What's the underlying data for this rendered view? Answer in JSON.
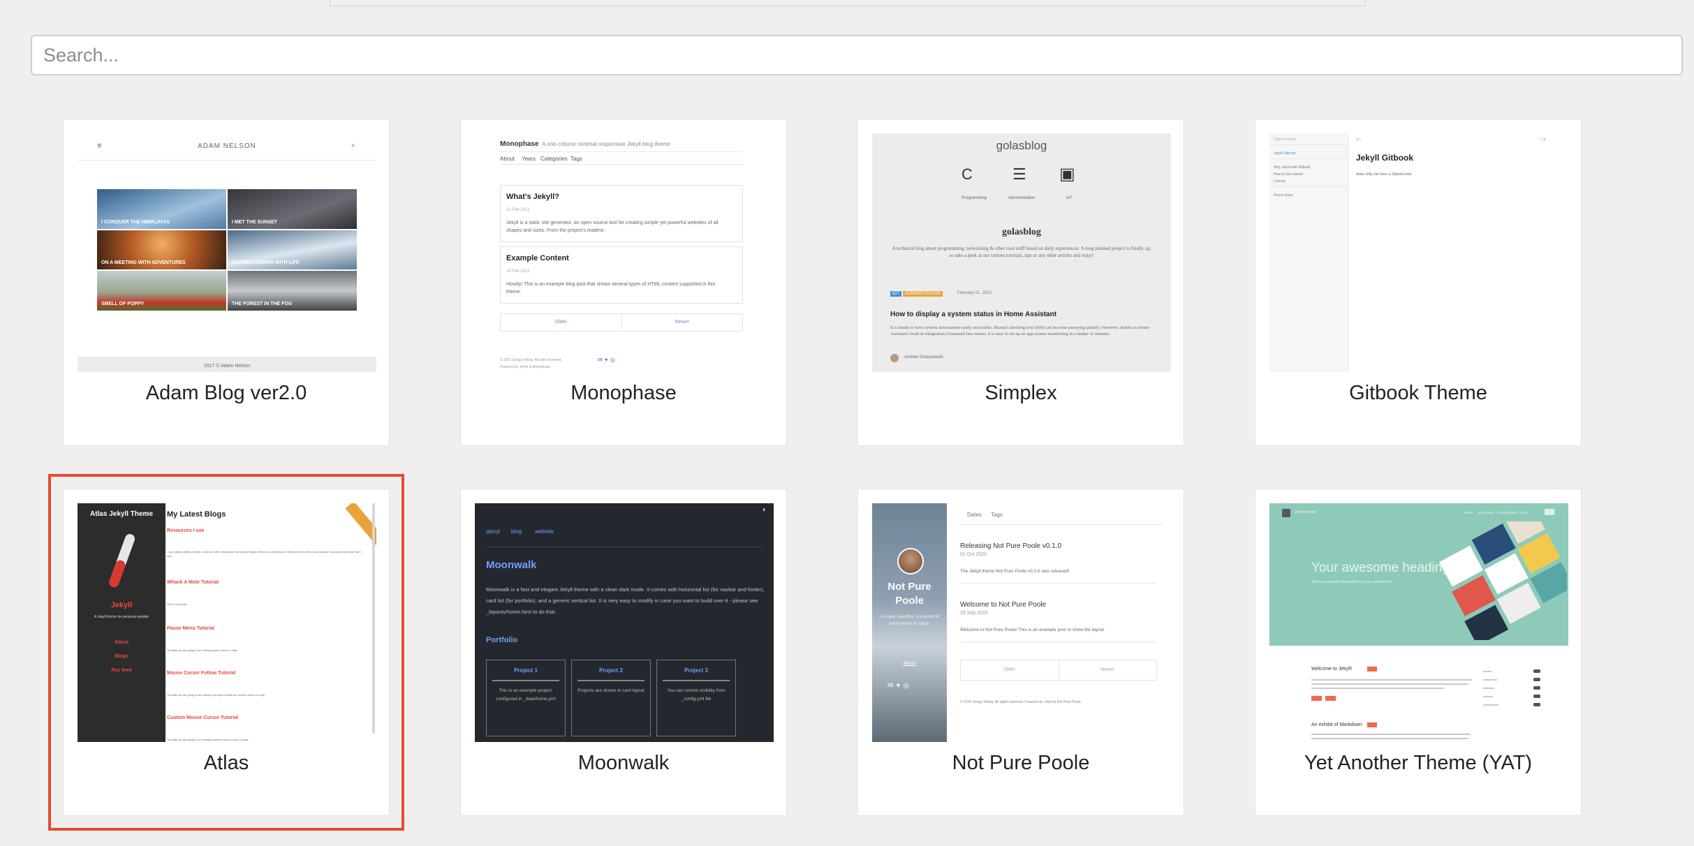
{
  "search": {
    "placeholder": "Search..."
  },
  "themes": [
    {
      "title": "Adam Blog ver2.0",
      "preview": {
        "brand": "ADAM NELSON",
        "tiles": [
          "I CONQUER THE HIMALAYAS",
          "I MET THE SUNSET",
          "ON A MEETING WITH ADVENTURES",
          "SNOWBOARDING WITH LIFE",
          "SMELL OF POPPY",
          "THE FOREST IN THE FOG"
        ],
        "footer": "2017 © Adam Nelson"
      }
    },
    {
      "title": "Monophase",
      "preview": {
        "brand": "Monophase",
        "tagline": "A one-column minimal responsive Jekyll blog theme",
        "nav": [
          "About",
          "Years",
          "Categories",
          "Tags"
        ],
        "posts": [
          {
            "title": "What's Jekyll?",
            "date": "21 Feb 2021",
            "excerpt": "Jekyll is a static site generator, an open-source tool for creating simple yet powerful websites of all shapes and sizes. From the project's readme:"
          },
          {
            "title": "Example Content",
            "date": "18 Feb 2021",
            "excerpt": "Howdy! This is an example blog post that shows several types of HTML content supported in this theme."
          }
        ],
        "pager": [
          "Older",
          "Newer"
        ],
        "footer": "© 2021 Songyi Wang. All right reserved.",
        "powered": "Powered by Jekyll & Monophase"
      }
    },
    {
      "title": "Simplex",
      "preview": {
        "brand": "golasblog",
        "cats": [
          "Programming",
          "Administration",
          "IoT"
        ],
        "heading": "golasblog",
        "desc": "A technical blog about programming, networking & other cool stuff based on daily experiences. A long planned project is finally up, so take a peek at our various tutorials, tips or any other articles and enjoy!",
        "tags": [
          "IOT",
          "ADMINISTRATION"
        ],
        "date": "February 01, 2021",
        "post": "How to display a system status in Home Assistant",
        "excerpt": "It is handy to have system information easily accessible. Manual checking (via SSH) can become annoying quickly. However, thanks to Home Assistant's built-in integration Command line sensor, it is easy to set up an app system monitoring in a matter of minutes.",
        "author": "Andrew Golaszewski"
      }
    },
    {
      "title": "Gitbook Theme",
      "preview": {
        "search": "Type to search",
        "nav": [
          "Jekyll Gitbook",
          "Why Jekyll with Gitbook",
          "How to Get started",
          "License",
          "Post a Issue"
        ],
        "heading": "Jekyll Gitbook",
        "text": "Make Jelly site have a Gitbook look!"
      }
    },
    {
      "title": "Atlas",
      "preview": {
        "brand": "Atlas Jekyll Theme",
        "name": "Jekyll",
        "tagline": "A Jekyll theme for personal website",
        "links": [
          "About",
          "Blogs",
          "Rss feed"
        ],
        "heading": "My Latest Blogs",
        "posts": [
          "Resources I use",
          "Whack A Mole Tutorial",
          "Pause Menu Tutorial",
          "Mouse Cursor Follow Tutorial",
          "Custom Mouse Cursor Tutorial"
        ],
        "snippets": [
          "I use a wide variety of sites, tools and other resources that can be helpful. Below is a collection of links to some of the most popular resources and tools that I use.",
          "This is a tutorial",
          "To today we are going to be making pause menu in unity.",
          "To today we are going to be making and object follow the mouse cursor in unity.",
          "To today we are going to be making custom mouse cursor in unity."
        ]
      }
    },
    {
      "title": "Moonwalk",
      "preview": {
        "nav": [
          "about",
          "blog",
          "website"
        ],
        "heading": "Moonwalk",
        "desc": "Moonwalk is a fast and elegant Jekyll theme with a clean dark mode. It comes with horizontal list (for navbar and footer), card list (for portfolio), and a generic vertical list. It is very easy to modify in case you want to build over it - please see _layouts/home.html to do that.",
        "section": "Portfolio",
        "projects": [
          {
            "title": "Project 1",
            "text": "This is an example project, configured in _data/home.yml"
          },
          {
            "title": "Project 2",
            "text": "Projects are shown in card layout"
          },
          {
            "title": "Project 3",
            "text": "You can control visibility from _config.yml file"
          }
        ]
      }
    },
    {
      "title": "Not Pure Poole",
      "preview": {
        "nav": [
          "Dates",
          "Tags"
        ],
        "brand": "Not Pure Poole",
        "tagline": "A simple, beautiful, and powerful Jekyll theme for blogs.",
        "about": "About",
        "posts": [
          {
            "title": "Releasing Not Pure Poole v0.1.0",
            "date": "01 Oct 2020",
            "excerpt": "The Jekyll theme Not Pure Poole v0.1.0 was released!"
          },
          {
            "title": "Welcome to Not Pure Poole",
            "date": "29 Sep 2020",
            "excerpt": "Welcome to Not Pure Poole! This is an example post to show the layout."
          }
        ],
        "pager": [
          "Older",
          "Newer"
        ],
        "footer": "© 2020 Songyi Wang. All rights reserved. Powered by Jekyll & Not Pure Poole."
      }
    },
    {
      "title": "Yet Another Theme (YAT)",
      "preview": {
        "brand": "Jeffreytse.net",
        "nav": [
          "HOME",
          "ARCHIVES",
          "CATEGORIES",
          "TAGS"
        ],
        "hero": "Your awesome heading",
        "hero_sub": "Write an awesome description for your new site here.",
        "posts": [
          "Welcome to Jekyll!",
          "An exhibit of Markdown"
        ]
      }
    }
  ],
  "colors": {
    "selection": "#e64a32",
    "atlas_accent": "#e8473c",
    "moonwalk_link": "#6ea1ff",
    "simplex_tag_blue": "#4a8fd4",
    "simplex_tag_orange": "#e8a33b",
    "yat_hero": "#8ecab9"
  }
}
